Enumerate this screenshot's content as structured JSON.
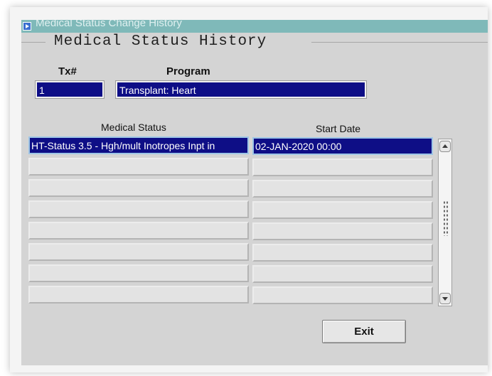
{
  "window": {
    "title": "Medical Status Change History"
  },
  "section": {
    "title": "Medical Status History"
  },
  "header": {
    "tx_label": "Tx#",
    "tx_value": "1",
    "program_label": "Program",
    "program_value": "Transplant: Heart"
  },
  "table": {
    "columns": [
      "Medical Status",
      "Start Date"
    ],
    "rows": [
      {
        "status": "HT-Status 3.5 - Hgh/mult Inotropes Inpt in",
        "start_date": "02-JAN-2020 00:00"
      },
      {
        "status": "",
        "start_date": ""
      },
      {
        "status": "",
        "start_date": ""
      },
      {
        "status": "",
        "start_date": ""
      },
      {
        "status": "",
        "start_date": ""
      },
      {
        "status": "",
        "start_date": ""
      },
      {
        "status": "",
        "start_date": ""
      },
      {
        "status": "",
        "start_date": ""
      }
    ]
  },
  "buttons": {
    "exit_label": "Exit"
  },
  "colors": {
    "selection": "#0e0e86",
    "titlebar": "#7fb9b9",
    "panel": "#d4d4d4"
  },
  "icons": [
    "app-icon",
    "scroll-up-icon",
    "scroll-down-icon",
    "scroll-grip-icon"
  ]
}
